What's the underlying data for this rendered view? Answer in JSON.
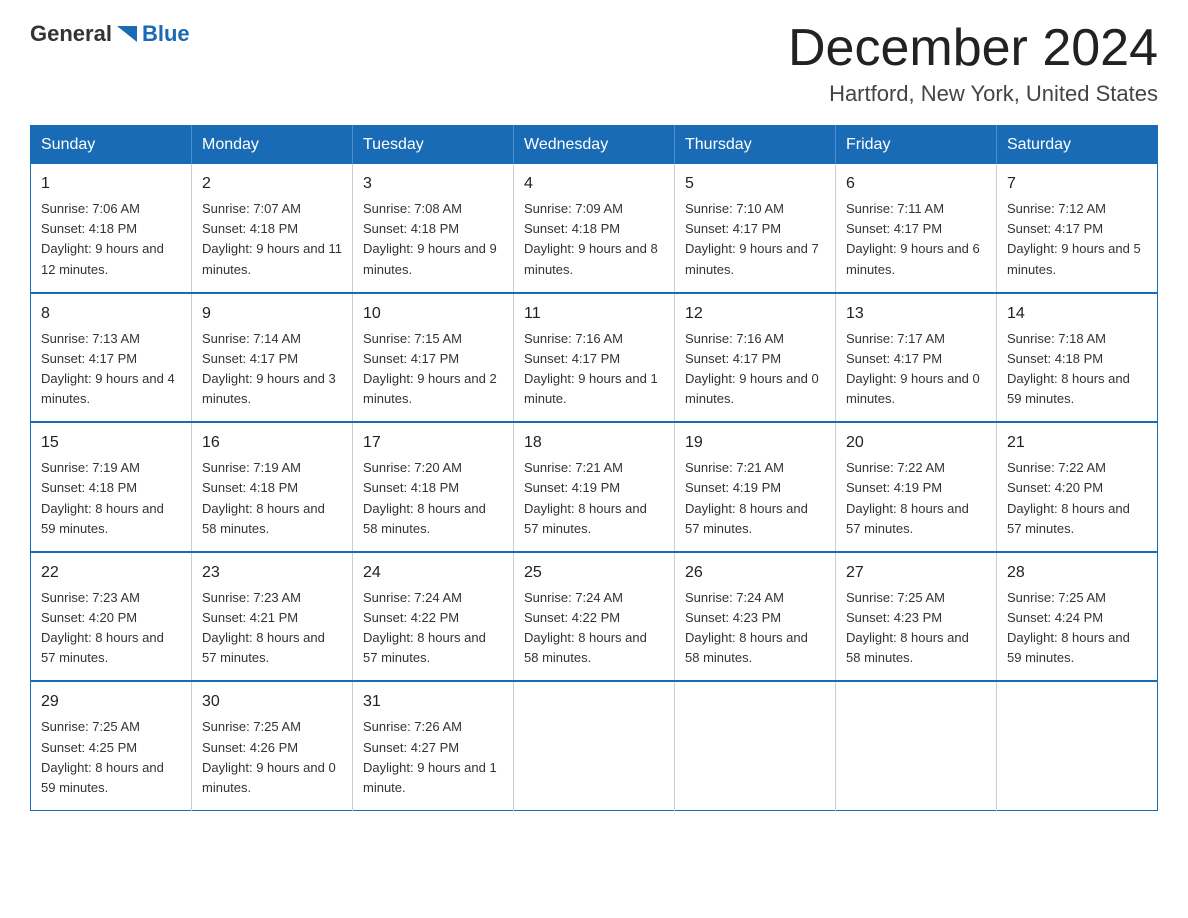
{
  "header": {
    "logo_general": "General",
    "logo_blue": "Blue",
    "title": "December 2024",
    "subtitle": "Hartford, New York, United States"
  },
  "days_of_week": [
    "Sunday",
    "Monday",
    "Tuesday",
    "Wednesday",
    "Thursday",
    "Friday",
    "Saturday"
  ],
  "weeks": [
    [
      {
        "day": "1",
        "sunrise": "7:06 AM",
        "sunset": "4:18 PM",
        "daylight": "9 hours and 12 minutes."
      },
      {
        "day": "2",
        "sunrise": "7:07 AM",
        "sunset": "4:18 PM",
        "daylight": "9 hours and 11 minutes."
      },
      {
        "day": "3",
        "sunrise": "7:08 AM",
        "sunset": "4:18 PM",
        "daylight": "9 hours and 9 minutes."
      },
      {
        "day": "4",
        "sunrise": "7:09 AM",
        "sunset": "4:18 PM",
        "daylight": "9 hours and 8 minutes."
      },
      {
        "day": "5",
        "sunrise": "7:10 AM",
        "sunset": "4:17 PM",
        "daylight": "9 hours and 7 minutes."
      },
      {
        "day": "6",
        "sunrise": "7:11 AM",
        "sunset": "4:17 PM",
        "daylight": "9 hours and 6 minutes."
      },
      {
        "day": "7",
        "sunrise": "7:12 AM",
        "sunset": "4:17 PM",
        "daylight": "9 hours and 5 minutes."
      }
    ],
    [
      {
        "day": "8",
        "sunrise": "7:13 AM",
        "sunset": "4:17 PM",
        "daylight": "9 hours and 4 minutes."
      },
      {
        "day": "9",
        "sunrise": "7:14 AM",
        "sunset": "4:17 PM",
        "daylight": "9 hours and 3 minutes."
      },
      {
        "day": "10",
        "sunrise": "7:15 AM",
        "sunset": "4:17 PM",
        "daylight": "9 hours and 2 minutes."
      },
      {
        "day": "11",
        "sunrise": "7:16 AM",
        "sunset": "4:17 PM",
        "daylight": "9 hours and 1 minute."
      },
      {
        "day": "12",
        "sunrise": "7:16 AM",
        "sunset": "4:17 PM",
        "daylight": "9 hours and 0 minutes."
      },
      {
        "day": "13",
        "sunrise": "7:17 AM",
        "sunset": "4:17 PM",
        "daylight": "9 hours and 0 minutes."
      },
      {
        "day": "14",
        "sunrise": "7:18 AM",
        "sunset": "4:18 PM",
        "daylight": "8 hours and 59 minutes."
      }
    ],
    [
      {
        "day": "15",
        "sunrise": "7:19 AM",
        "sunset": "4:18 PM",
        "daylight": "8 hours and 59 minutes."
      },
      {
        "day": "16",
        "sunrise": "7:19 AM",
        "sunset": "4:18 PM",
        "daylight": "8 hours and 58 minutes."
      },
      {
        "day": "17",
        "sunrise": "7:20 AM",
        "sunset": "4:18 PM",
        "daylight": "8 hours and 58 minutes."
      },
      {
        "day": "18",
        "sunrise": "7:21 AM",
        "sunset": "4:19 PM",
        "daylight": "8 hours and 57 minutes."
      },
      {
        "day": "19",
        "sunrise": "7:21 AM",
        "sunset": "4:19 PM",
        "daylight": "8 hours and 57 minutes."
      },
      {
        "day": "20",
        "sunrise": "7:22 AM",
        "sunset": "4:19 PM",
        "daylight": "8 hours and 57 minutes."
      },
      {
        "day": "21",
        "sunrise": "7:22 AM",
        "sunset": "4:20 PM",
        "daylight": "8 hours and 57 minutes."
      }
    ],
    [
      {
        "day": "22",
        "sunrise": "7:23 AM",
        "sunset": "4:20 PM",
        "daylight": "8 hours and 57 minutes."
      },
      {
        "day": "23",
        "sunrise": "7:23 AM",
        "sunset": "4:21 PM",
        "daylight": "8 hours and 57 minutes."
      },
      {
        "day": "24",
        "sunrise": "7:24 AM",
        "sunset": "4:22 PM",
        "daylight": "8 hours and 57 minutes."
      },
      {
        "day": "25",
        "sunrise": "7:24 AM",
        "sunset": "4:22 PM",
        "daylight": "8 hours and 58 minutes."
      },
      {
        "day": "26",
        "sunrise": "7:24 AM",
        "sunset": "4:23 PM",
        "daylight": "8 hours and 58 minutes."
      },
      {
        "day": "27",
        "sunrise": "7:25 AM",
        "sunset": "4:23 PM",
        "daylight": "8 hours and 58 minutes."
      },
      {
        "day": "28",
        "sunrise": "7:25 AM",
        "sunset": "4:24 PM",
        "daylight": "8 hours and 59 minutes."
      }
    ],
    [
      {
        "day": "29",
        "sunrise": "7:25 AM",
        "sunset": "4:25 PM",
        "daylight": "8 hours and 59 minutes."
      },
      {
        "day": "30",
        "sunrise": "7:25 AM",
        "sunset": "4:26 PM",
        "daylight": "9 hours and 0 minutes."
      },
      {
        "day": "31",
        "sunrise": "7:26 AM",
        "sunset": "4:27 PM",
        "daylight": "9 hours and 1 minute."
      },
      null,
      null,
      null,
      null
    ]
  ]
}
